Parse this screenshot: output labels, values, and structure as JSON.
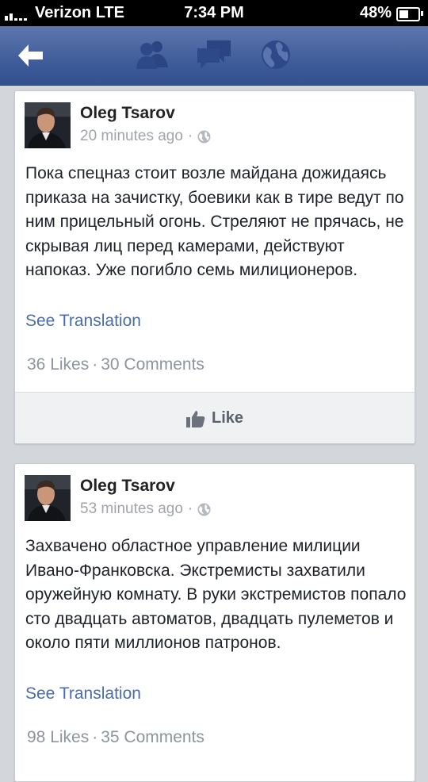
{
  "status_bar": {
    "carrier": "Verizon  LTE",
    "time": "7:34 PM",
    "battery": "48%",
    "battery_level": 0.48
  },
  "nav": {
    "icons": [
      "back-arrow-icon",
      "friends-icon",
      "messages-icon",
      "globe-icon"
    ]
  },
  "posts": [
    {
      "author": "Oleg Tsarov",
      "time": "20 minutes ago",
      "dot": "·",
      "text": "Пока спецназ стоит возле майдана дожидаясь приказа на зачистку, боевики как в тире ведут по ним прицельный огонь. Стреляют не прячась, не скрывая лиц перед камерами, действуют напоказ. Уже погибло семь милиционеров.",
      "see_translation": "See Translation",
      "likes": "36 Likes",
      "separator": "·",
      "comments": "30 Comments",
      "like_label": "Like"
    },
    {
      "author": "Oleg Tsarov",
      "time": "53 minutes ago",
      "dot": "·",
      "text": "Захвачено областное управление милиции Ивано-Франковска. Экстремисты захватили оружейную комнату. В руки экстремистов попало сто двадцать автоматов, двадцать пулеметов и около пяти миллионов патронов.",
      "see_translation": "See Translation",
      "likes": "98 Likes",
      "separator": "·",
      "comments": "35 Comments"
    }
  ],
  "colors": {
    "nav_blue": "#3b5998",
    "link_blue": "#4a6da7",
    "muted_gray": "#8d949e",
    "feed_background": "#d3d6db"
  }
}
